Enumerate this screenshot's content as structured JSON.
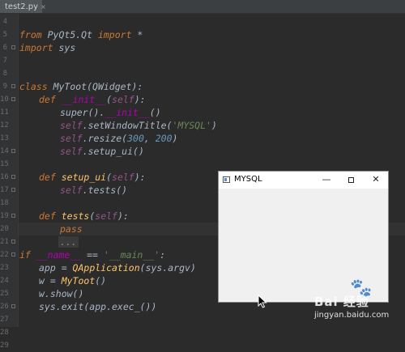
{
  "editor": {
    "tab": {
      "filename": "test2.py",
      "close_glyph": "×",
      "icon": "python-file-icon"
    },
    "line_numbers": [
      "4",
      "5",
      "6",
      "7",
      "8",
      "9",
      "10",
      "11",
      "12",
      "13",
      "14",
      "15",
      "16",
      "17",
      "18",
      "19",
      "20",
      "21",
      "22",
      "23",
      "24",
      "25",
      "26",
      "27",
      "28",
      "29"
    ],
    "code": {
      "l5": [
        "from",
        " PyQt5.Qt ",
        "import",
        " *"
      ],
      "l6": [
        "import",
        " sys"
      ],
      "l9": [
        "class",
        " ",
        "MyToot",
        "(QWidget):"
      ],
      "l10": [
        "def",
        " ",
        "__init__",
        "(",
        "self",
        "):"
      ],
      "l11": [
        "super",
        "().",
        "__init__",
        "()"
      ],
      "l12": [
        "self",
        ".setWindowTitle(",
        "'MYSQL'",
        ")"
      ],
      "l13": [
        "self",
        ".resize(",
        "300",
        ", ",
        "200",
        ")"
      ],
      "l14": [
        "self",
        ".setup_ui()"
      ],
      "l16": [
        "def",
        " ",
        "setup_ui",
        "(",
        "self",
        "):"
      ],
      "l17": [
        "self",
        ".tests()"
      ],
      "l19": [
        "def",
        " ",
        "tests",
        "(",
        "self",
        "):"
      ],
      "l20": [
        "pass"
      ],
      "l21": [
        "..."
      ],
      "l22": [
        "if",
        " ",
        "__name__",
        " == ",
        "'__main__'",
        ":"
      ],
      "l23": [
        "app = ",
        "QApplication",
        "(sys.argv)"
      ],
      "l24": [
        "w = ",
        "MyToot",
        "()"
      ],
      "l25": [
        "w.show()"
      ],
      "l26": [
        "sys.exit(app.exec_())"
      ]
    }
  },
  "qt_window": {
    "title": "MYSQL",
    "minimize_glyph": "—",
    "close_glyph": "✕"
  },
  "watermark": {
    "logo_glyph": "🐾",
    "brand": "Bai 经验",
    "url": "jingyan.baidu.com"
  },
  "colors": {
    "editor_bg": "#2b2b2b",
    "keyword": "#cc7832",
    "string": "#6a8759",
    "number": "#6897bb",
    "self": "#94558d",
    "dunder": "#b200b2"
  }
}
